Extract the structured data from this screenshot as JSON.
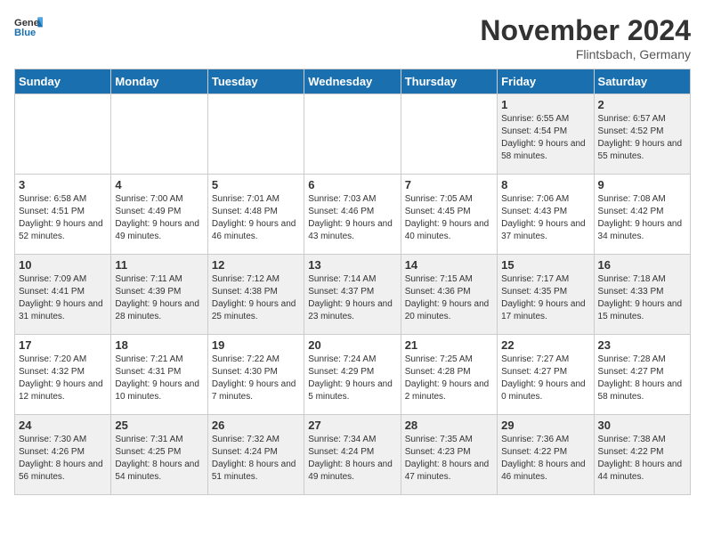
{
  "header": {
    "logo_general": "General",
    "logo_blue": "Blue",
    "title": "November 2024",
    "location": "Flintsbach, Germany"
  },
  "weekdays": [
    "Sunday",
    "Monday",
    "Tuesday",
    "Wednesday",
    "Thursday",
    "Friday",
    "Saturday"
  ],
  "weeks": [
    [
      {
        "day": "",
        "detail": ""
      },
      {
        "day": "",
        "detail": ""
      },
      {
        "day": "",
        "detail": ""
      },
      {
        "day": "",
        "detail": ""
      },
      {
        "day": "",
        "detail": ""
      },
      {
        "day": "1",
        "detail": "Sunrise: 6:55 AM\nSunset: 4:54 PM\nDaylight: 9 hours and 58 minutes."
      },
      {
        "day": "2",
        "detail": "Sunrise: 6:57 AM\nSunset: 4:52 PM\nDaylight: 9 hours and 55 minutes."
      }
    ],
    [
      {
        "day": "3",
        "detail": "Sunrise: 6:58 AM\nSunset: 4:51 PM\nDaylight: 9 hours and 52 minutes."
      },
      {
        "day": "4",
        "detail": "Sunrise: 7:00 AM\nSunset: 4:49 PM\nDaylight: 9 hours and 49 minutes."
      },
      {
        "day": "5",
        "detail": "Sunrise: 7:01 AM\nSunset: 4:48 PM\nDaylight: 9 hours and 46 minutes."
      },
      {
        "day": "6",
        "detail": "Sunrise: 7:03 AM\nSunset: 4:46 PM\nDaylight: 9 hours and 43 minutes."
      },
      {
        "day": "7",
        "detail": "Sunrise: 7:05 AM\nSunset: 4:45 PM\nDaylight: 9 hours and 40 minutes."
      },
      {
        "day": "8",
        "detail": "Sunrise: 7:06 AM\nSunset: 4:43 PM\nDaylight: 9 hours and 37 minutes."
      },
      {
        "day": "9",
        "detail": "Sunrise: 7:08 AM\nSunset: 4:42 PM\nDaylight: 9 hours and 34 minutes."
      }
    ],
    [
      {
        "day": "10",
        "detail": "Sunrise: 7:09 AM\nSunset: 4:41 PM\nDaylight: 9 hours and 31 minutes."
      },
      {
        "day": "11",
        "detail": "Sunrise: 7:11 AM\nSunset: 4:39 PM\nDaylight: 9 hours and 28 minutes."
      },
      {
        "day": "12",
        "detail": "Sunrise: 7:12 AM\nSunset: 4:38 PM\nDaylight: 9 hours and 25 minutes."
      },
      {
        "day": "13",
        "detail": "Sunrise: 7:14 AM\nSunset: 4:37 PM\nDaylight: 9 hours and 23 minutes."
      },
      {
        "day": "14",
        "detail": "Sunrise: 7:15 AM\nSunset: 4:36 PM\nDaylight: 9 hours and 20 minutes."
      },
      {
        "day": "15",
        "detail": "Sunrise: 7:17 AM\nSunset: 4:35 PM\nDaylight: 9 hours and 17 minutes."
      },
      {
        "day": "16",
        "detail": "Sunrise: 7:18 AM\nSunset: 4:33 PM\nDaylight: 9 hours and 15 minutes."
      }
    ],
    [
      {
        "day": "17",
        "detail": "Sunrise: 7:20 AM\nSunset: 4:32 PM\nDaylight: 9 hours and 12 minutes."
      },
      {
        "day": "18",
        "detail": "Sunrise: 7:21 AM\nSunset: 4:31 PM\nDaylight: 9 hours and 10 minutes."
      },
      {
        "day": "19",
        "detail": "Sunrise: 7:22 AM\nSunset: 4:30 PM\nDaylight: 9 hours and 7 minutes."
      },
      {
        "day": "20",
        "detail": "Sunrise: 7:24 AM\nSunset: 4:29 PM\nDaylight: 9 hours and 5 minutes."
      },
      {
        "day": "21",
        "detail": "Sunrise: 7:25 AM\nSunset: 4:28 PM\nDaylight: 9 hours and 2 minutes."
      },
      {
        "day": "22",
        "detail": "Sunrise: 7:27 AM\nSunset: 4:27 PM\nDaylight: 9 hours and 0 minutes."
      },
      {
        "day": "23",
        "detail": "Sunrise: 7:28 AM\nSunset: 4:27 PM\nDaylight: 8 hours and 58 minutes."
      }
    ],
    [
      {
        "day": "24",
        "detail": "Sunrise: 7:30 AM\nSunset: 4:26 PM\nDaylight: 8 hours and 56 minutes."
      },
      {
        "day": "25",
        "detail": "Sunrise: 7:31 AM\nSunset: 4:25 PM\nDaylight: 8 hours and 54 minutes."
      },
      {
        "day": "26",
        "detail": "Sunrise: 7:32 AM\nSunset: 4:24 PM\nDaylight: 8 hours and 51 minutes."
      },
      {
        "day": "27",
        "detail": "Sunrise: 7:34 AM\nSunset: 4:24 PM\nDaylight: 8 hours and 49 minutes."
      },
      {
        "day": "28",
        "detail": "Sunrise: 7:35 AM\nSunset: 4:23 PM\nDaylight: 8 hours and 47 minutes."
      },
      {
        "day": "29",
        "detail": "Sunrise: 7:36 AM\nSunset: 4:22 PM\nDaylight: 8 hours and 46 minutes."
      },
      {
        "day": "30",
        "detail": "Sunrise: 7:38 AM\nSunset: 4:22 PM\nDaylight: 8 hours and 44 minutes."
      }
    ]
  ]
}
